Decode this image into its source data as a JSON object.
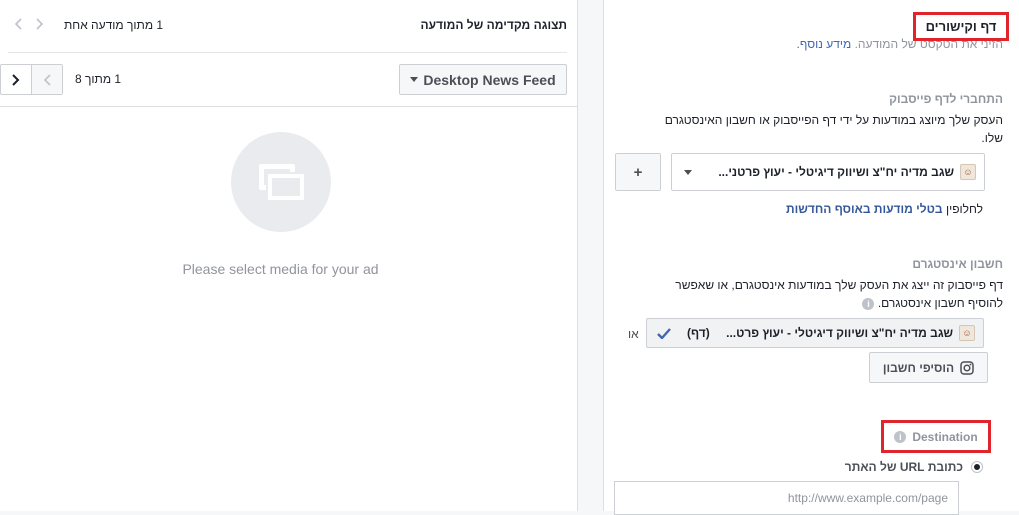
{
  "preview": {
    "title": "תצוגה מקדימה של המודעה",
    "ad_count": "1 מתוך מודעה אחת",
    "placement_label": "Desktop News Feed",
    "placement_count": "1 מתוך 8",
    "empty_message": "Please select media for your ad"
  },
  "settings": {
    "section_title": "דף וקישורים",
    "section_subtitle": "הזיני את הטקסט של המודעה.",
    "section_subtitle_link": "מידע נוסף.",
    "facebook_page": {
      "label": "התחברי לדף פייסבוק",
      "description": "העסק שלך מיוצג במודעות על ידי דף הפייסבוק או חשבון האינסטגרם שלו.",
      "selected_page": "שגב מדיה יח\"צ ושיווק דיגיטלי - יעוץ פרטני...",
      "add_label": "+",
      "switch_prefix": "לחלופין",
      "switch_link": "בטלי מודעות באוסף החדשות"
    },
    "instagram": {
      "label": "חשבון אינסטגרם",
      "description": "דף פייסבוק זה ייצג את העסק שלך במודעות אינסטגרם, או שאפשר להוסיף חשבון אינסטגרם.",
      "selected_account": "שגב מדיה יח\"צ ושיווק דיגיטלי - יעוץ פרט...",
      "selected_tag": "(דף)",
      "or_label": "או",
      "add_account_label": "הוסיפי חשבון"
    },
    "destination": {
      "label": "Destination",
      "option_label": "כתובת URL של האתר",
      "url_placeholder": "http://www.example.com/page"
    }
  },
  "colors": {
    "highlight_border": "#e0242b",
    "link_blue": "#365899",
    "check_blue": "#4267b2"
  },
  "icons": {
    "media_placeholder": "images-icon",
    "instagram": "instagram-icon",
    "check": "check-icon",
    "info": "info-icon"
  }
}
